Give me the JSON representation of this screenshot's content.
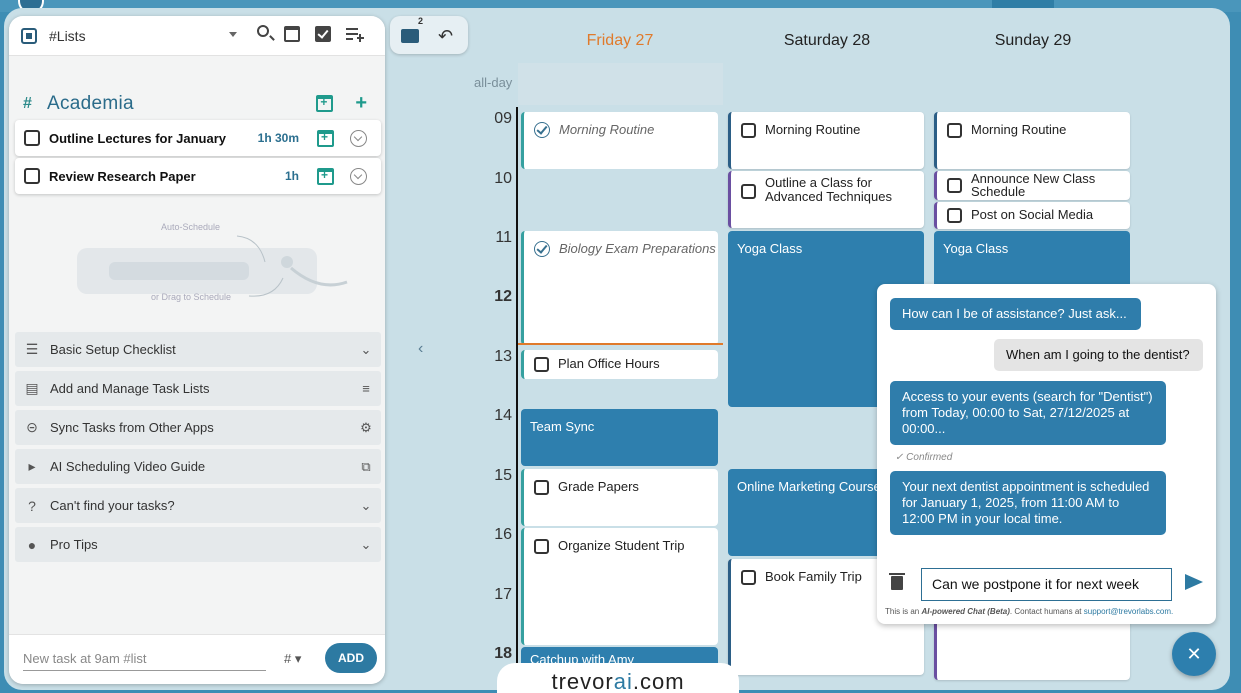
{
  "left_panel": {
    "list_selector": "#Lists",
    "section": {
      "name": "Academia"
    },
    "tasks": [
      {
        "title": "Outline Lectures for January",
        "duration": "1h 30m"
      },
      {
        "title": "Review Research Paper",
        "duration": "1h"
      }
    ],
    "illustration": {
      "auto_schedule": "Auto-Schedule",
      "drag": "or Drag to Schedule"
    },
    "accordion": [
      {
        "label": "Basic Setup Checklist",
        "icon": "checklist-icon",
        "end": "chevron-down-icon"
      },
      {
        "label": "Add and Manage Task Lists",
        "icon": "list-icon",
        "end": "playlist-add-icon"
      },
      {
        "label": "Sync Tasks from Other Apps",
        "icon": "link-icon",
        "end": "gear-icon"
      },
      {
        "label": "AI Scheduling Video Guide",
        "icon": "play-icon",
        "end": "external-link-icon"
      },
      {
        "label": "Can't find your tasks?",
        "icon": "help-icon",
        "end": "chevron-down-icon"
      },
      {
        "label": "Pro Tips",
        "icon": "lightbulb-icon",
        "end": "chevron-down-icon"
      }
    ],
    "new_task_placeholder": "New task at 9am #list",
    "hash_select": "#",
    "add_button": "ADD"
  },
  "toolbar": {
    "badge": "2"
  },
  "calendar": {
    "days": [
      {
        "label": "Friday 27",
        "today": true
      },
      {
        "label": "Saturday 28",
        "today": false
      },
      {
        "label": "Sunday 29",
        "today": false
      }
    ],
    "allday_label": "all-day",
    "hours": [
      "09",
      "10",
      "11",
      "12",
      "13",
      "14",
      "15",
      "16",
      "17",
      "18"
    ],
    "events": {
      "fri_morning": "Morning Routine",
      "fri_biology": "Biology Exam Preparations",
      "fri_office": "Plan Office Hours",
      "fri_team": "Team Sync",
      "fri_grade": "Grade Papers",
      "fri_trip": "Organize Student Trip",
      "fri_catchup": "Catchup with Amy",
      "sat_morning": "Morning Routine",
      "sat_outline": "Outline a Class for Advanced Techniques",
      "sat_yoga": "Yoga Class",
      "sat_marketing": "Online Marketing Course",
      "sat_family": "Book Family Trip",
      "sun_morning": "Morning Routine",
      "sun_announce": "Announce New Class Schedule",
      "sun_post": "Post on Social Media",
      "sun_yoga": "Yoga Class"
    }
  },
  "chat": {
    "messages": [
      {
        "from": "ai",
        "text": "How can I be of assistance? Just ask..."
      },
      {
        "from": "user",
        "text": "When am I going to the dentist?"
      },
      {
        "from": "ai",
        "text": "Access to your events (search for \"Dentist\") from Today, 00:00 to Sat, 27/12/2025 at 00:00..."
      },
      {
        "from": "ai",
        "text": "Your next dentist appointment is scheduled for January 1, 2025, from 11:00 AM to 12:00 PM in your local time."
      }
    ],
    "confirmed": "Confirmed",
    "input_value": "Can we postpone it for next week",
    "disclaimer_prefix": "This is an ",
    "disclaimer_ai": "AI-powered Chat (Beta)",
    "disclaimer_suffix": ". Contact humans at ",
    "disclaimer_email": "support@trevorlabs.com."
  },
  "brand": {
    "pre": "trevor",
    "ai": "ai",
    "post": ".com"
  },
  "colors": {
    "accent": "#2d7aa2",
    "today": "#e07a2b",
    "teal": "#1f9a8c"
  }
}
